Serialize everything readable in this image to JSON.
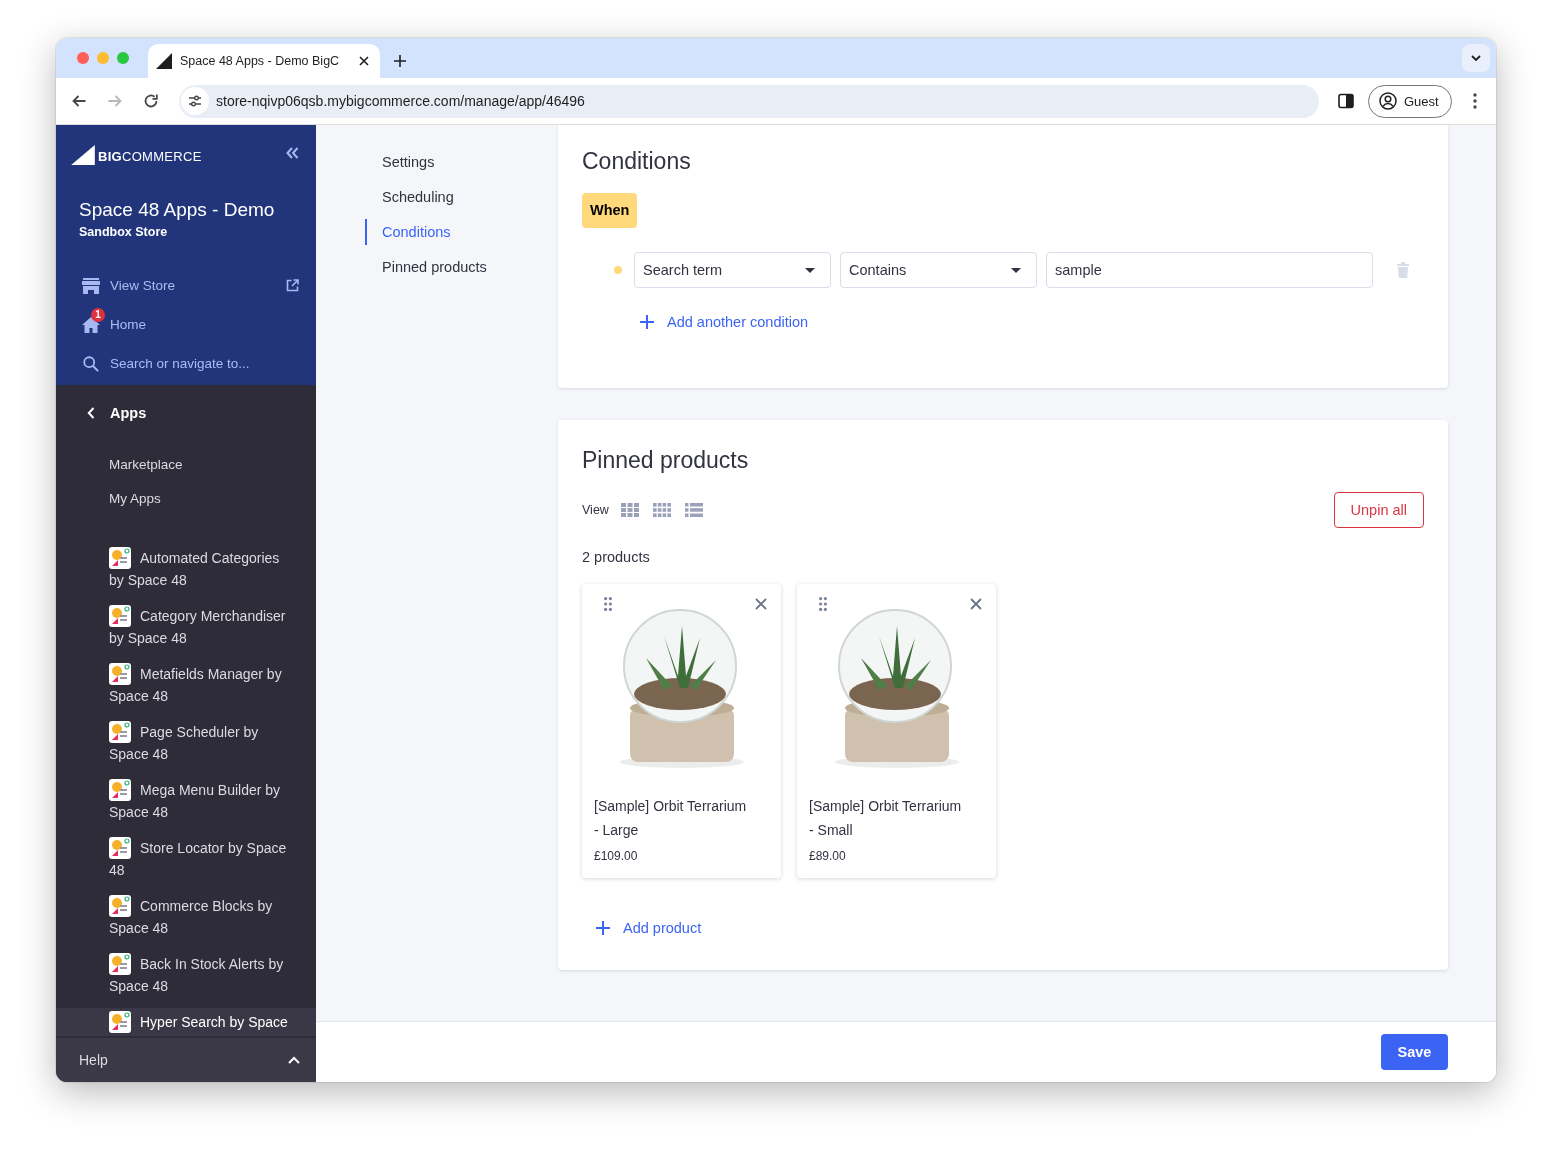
{
  "browser": {
    "tab_title": "Space 48 Apps - Demo BigC",
    "url": "store-nqivp06qsb.mybigcommerce.com/manage/app/46496",
    "forward_disabled": true,
    "profile": "Guest"
  },
  "sidebar": {
    "logo": "**BIG**COMMERCE",
    "store_name": "Space 48 Apps - Demo",
    "store_type": "Sandbox Store",
    "nav": [
      {
        "kind": "store",
        "label": "View Store",
        "external": true
      },
      {
        "kind": "home",
        "label": "Home",
        "badge": "1",
        "external": false
      },
      {
        "kind": "search",
        "placeholder": "Search or navigate to...",
        "external": false
      }
    ],
    "section": "Apps",
    "links": [
      "Marketplace",
      "My Apps"
    ],
    "apps": [
      {
        "label": "Automated Categories by Space 48",
        "selected": false
      },
      {
        "label": "Category Merchandiser by Space 48",
        "selected": false
      },
      {
        "label": "Metafields Manager by Space 48",
        "selected": false
      },
      {
        "label": "Page Scheduler by Space 48",
        "selected": false
      },
      {
        "label": "Mega Menu Builder by Space 48",
        "selected": false
      },
      {
        "label": "Store Locator by Space 48",
        "selected": false
      },
      {
        "label": "Commerce Blocks by Space 48",
        "selected": false
      },
      {
        "label": "Back In Stock Alerts by Space 48",
        "selected": false
      },
      {
        "label": "Hyper Search by Space",
        "selected": true
      }
    ],
    "help": "Help"
  },
  "subnav": [
    {
      "label": "Settings",
      "selected": false
    },
    {
      "label": "Scheduling",
      "selected": false
    },
    {
      "label": "Conditions",
      "selected": true
    },
    {
      "label": "Pinned products",
      "selected": false
    }
  ],
  "conditions": {
    "title": "Conditions",
    "operator_badge": "When",
    "rows": [
      {
        "field": "Search term",
        "operator": "Contains",
        "value": "sample"
      }
    ],
    "add_label": "Add another condition"
  },
  "pinned_products": {
    "title": "Pinned products",
    "view_label": "View",
    "unpin_label": "Unpin all",
    "count": "2 products",
    "products": [
      {
        "name": "[Sample] Orbit Terrarium - Large",
        "price": "£109.00"
      },
      {
        "name": "[Sample] Orbit Terrarium - Small",
        "price": "£89.00"
      }
    ],
    "add_label": "Add product"
  },
  "action_bar": {
    "save_label": "Save"
  }
}
